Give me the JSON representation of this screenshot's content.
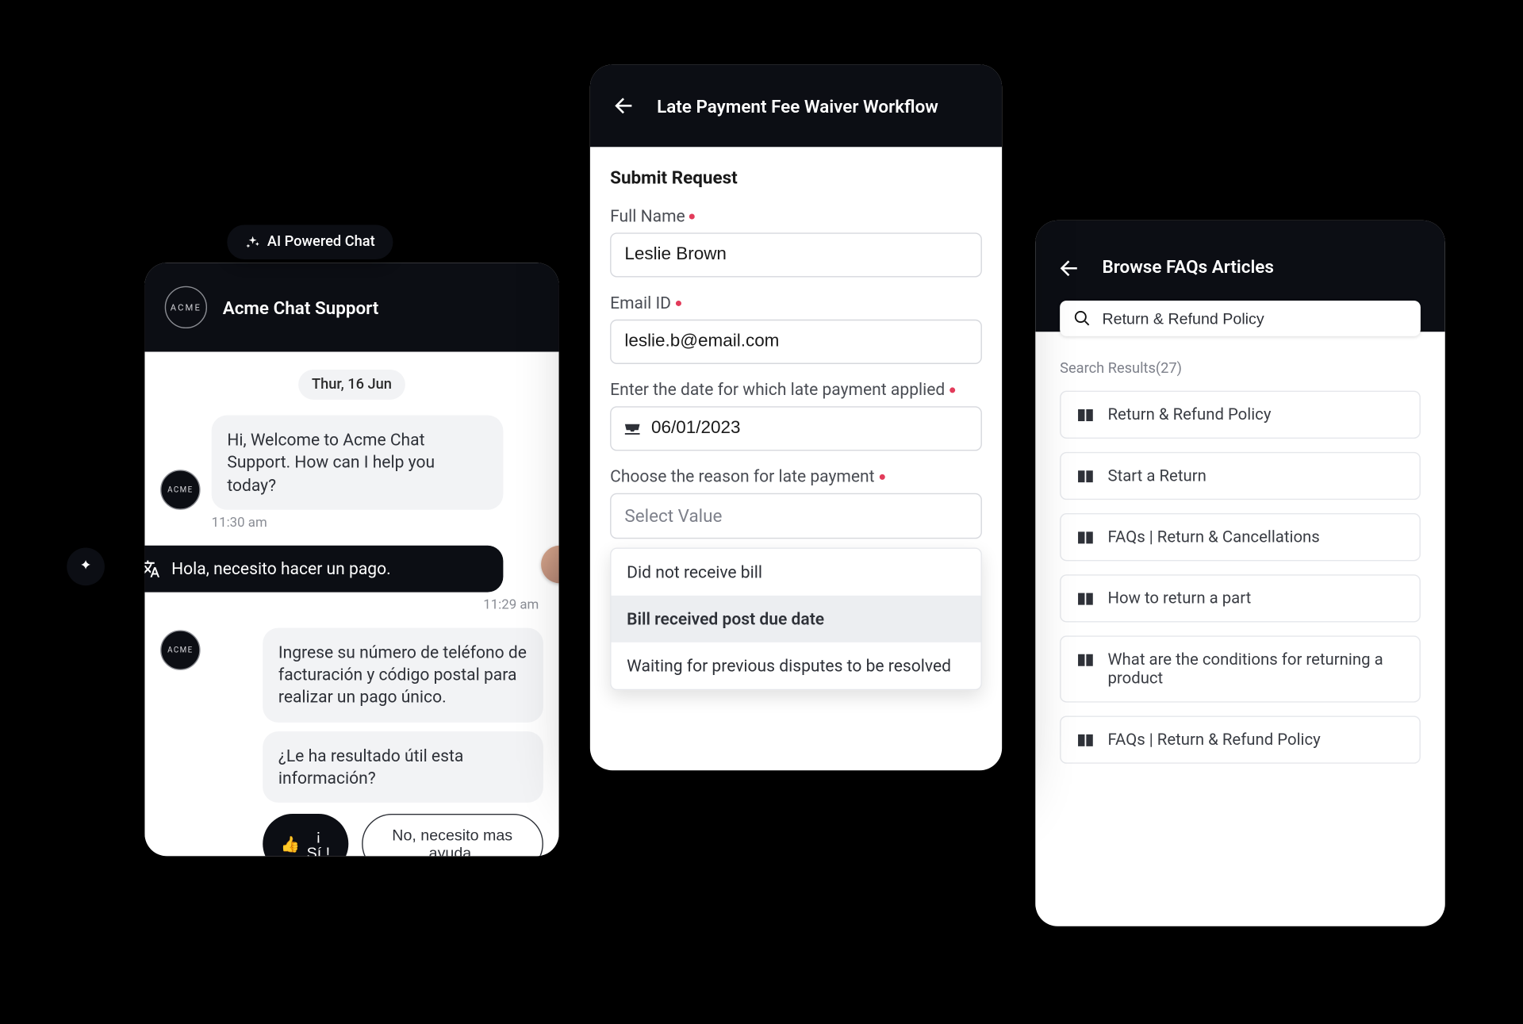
{
  "chat": {
    "badge": "AI Powered Chat",
    "logo_text": "ACME",
    "title": "Acme Chat Support",
    "date_chip": "Thur, 16 Jun",
    "bot_welcome": "Hi, Welcome to Acme Chat Support. How can I help you today?",
    "bot_welcome_ts": "11:30 am",
    "user_msg": "Hola, necesito hacer un pago.",
    "user_ts": "11:29 am",
    "bot_reply_1": "Ingrese su número de teléfono de facturación y código postal para realizar un pago único.",
    "bot_reply_2": "¿Le ha resultado útil esta información?",
    "yes_btn": "¡ Sí !",
    "no_btn": "No, necesito mas ayuda."
  },
  "form": {
    "header_title": "Late Payment Fee Waiver Workflow",
    "section_title": "Submit Request",
    "full_name_label": "Full Name",
    "full_name_value": "Leslie Brown",
    "email_label": "Email ID",
    "email_value": "leslie.b@email.com",
    "date_label": "Enter the date for which late payment applied",
    "date_value": "06/01/2023",
    "reason_label": "Choose the reason for late payment",
    "reason_placeholder": "Select Value",
    "options": [
      "Did not receive bill",
      "Bill received post due date",
      "Waiting for previous disputes to be resolved"
    ],
    "selected_option_index": 1
  },
  "faq": {
    "header_title": "Browse FAQs Articles",
    "search_value": "Return & Refund Policy",
    "results_label": "Search Results(27)",
    "items": [
      "Return & Refund Policy",
      "Start a Return",
      "FAQs | Return & Cancellations",
      "How to return a part",
      "What are the conditions for returning a product",
      "FAQs | Return & Refund Policy"
    ]
  }
}
